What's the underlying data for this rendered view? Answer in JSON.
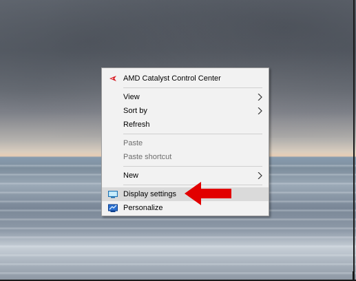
{
  "context_menu": {
    "items": [
      {
        "label": "AMD Catalyst Control Center",
        "icon": "amd-catalyst-icon"
      },
      {
        "label": "View",
        "submenu": true
      },
      {
        "label": "Sort by",
        "submenu": true
      },
      {
        "label": "Refresh"
      },
      {
        "label": "Paste",
        "disabled": true
      },
      {
        "label": "Paste shortcut",
        "disabled": true
      },
      {
        "label": "New",
        "submenu": true
      },
      {
        "label": "Display settings",
        "icon": "display-settings-icon",
        "highlighted": true
      },
      {
        "label": "Personalize",
        "icon": "personalize-icon"
      }
    ]
  },
  "annotation": {
    "arrow_color": "#e20000",
    "points_to": "Display settings"
  },
  "colors": {
    "menu_bg": "#f2f2f2",
    "highlight_bg": "#dadada",
    "disabled_text": "#6d6d6d"
  }
}
